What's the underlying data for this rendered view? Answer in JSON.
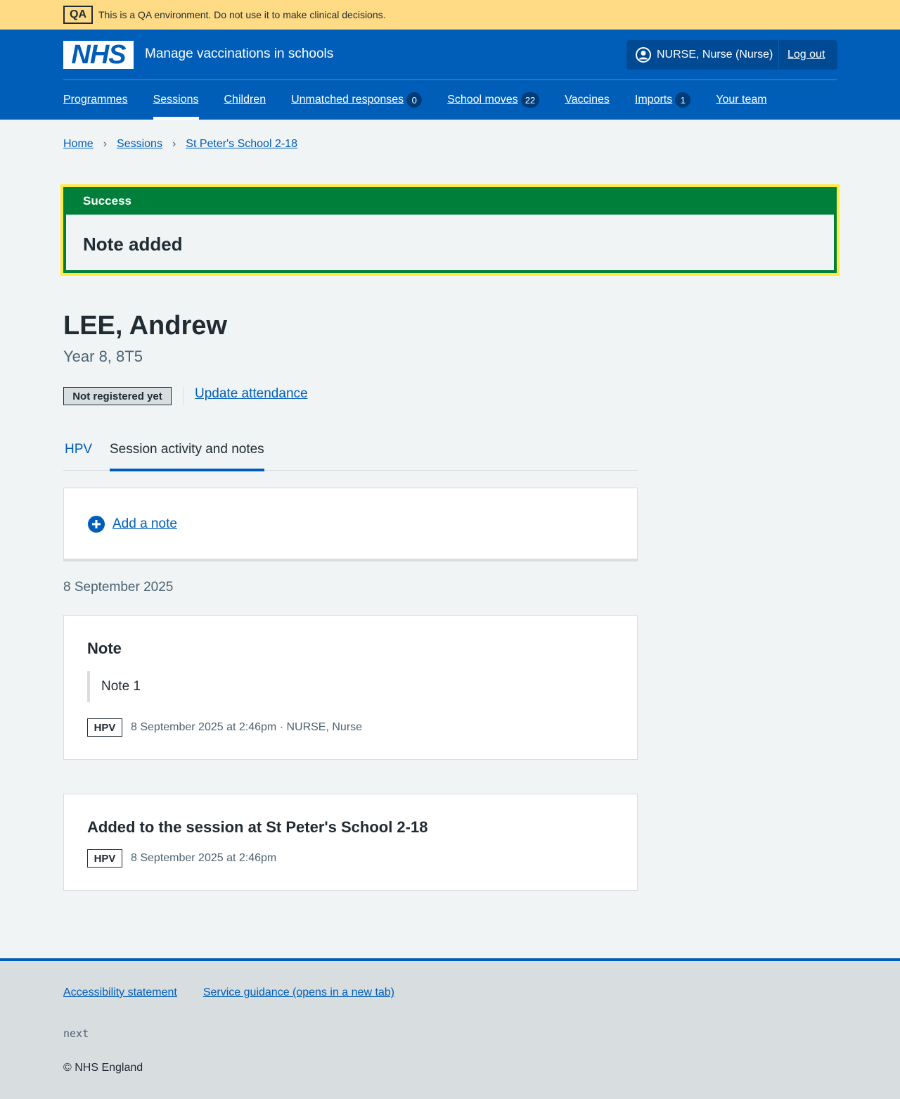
{
  "qa_banner": {
    "tag": "QA",
    "text": "This is a QA environment. Do not use it to make clinical decisions."
  },
  "header": {
    "logo": "NHS",
    "service_name": "Manage vaccinations in schools",
    "user": "NURSE, Nurse (Nurse)",
    "logout": "Log out",
    "nav": [
      {
        "label": "Programmes",
        "count": null,
        "active": false
      },
      {
        "label": "Sessions",
        "count": null,
        "active": true
      },
      {
        "label": "Children",
        "count": null,
        "active": false
      },
      {
        "label": "Unmatched responses",
        "count": "0",
        "active": false
      },
      {
        "label": "School moves",
        "count": "22",
        "active": false
      },
      {
        "label": "Vaccines",
        "count": null,
        "active": false
      },
      {
        "label": "Imports",
        "count": "1",
        "active": false
      },
      {
        "label": "Your team",
        "count": null,
        "active": false
      }
    ]
  },
  "breadcrumb": [
    "Home",
    "Sessions",
    "St Peter's School 2-18"
  ],
  "success": {
    "heading": "Success",
    "message": "Note added"
  },
  "patient": {
    "name": "LEE, Andrew",
    "year_group": "Year 8, 8T5",
    "registration_status": "Not registered yet",
    "update_attendance": "Update attendance"
  },
  "tabs": [
    {
      "label": "HPV",
      "active": false
    },
    {
      "label": "Session activity and notes",
      "active": true
    }
  ],
  "add_note": "Add a note",
  "activity": {
    "date_heading": "8 September 2025",
    "note_card": {
      "title": "Note",
      "body": "Note 1",
      "programme": "HPV",
      "meta": "8 September 2025 at 2:46pm · NURSE, Nurse"
    },
    "session_card": {
      "title": "Added to the session at St Peter's School 2-18",
      "programme": "HPV",
      "meta": "8 September 2025 at 2:46pm"
    }
  },
  "footer": {
    "links": [
      "Accessibility statement",
      "Service guidance (opens in a new tab)"
    ],
    "version": "next",
    "copyright": "© NHS England"
  },
  "colors": {
    "nhs_blue": "#005eb8",
    "success_green": "#007f3b",
    "qa_yellow": "#ffdb86",
    "focus_yellow": "#ffeb3b"
  }
}
